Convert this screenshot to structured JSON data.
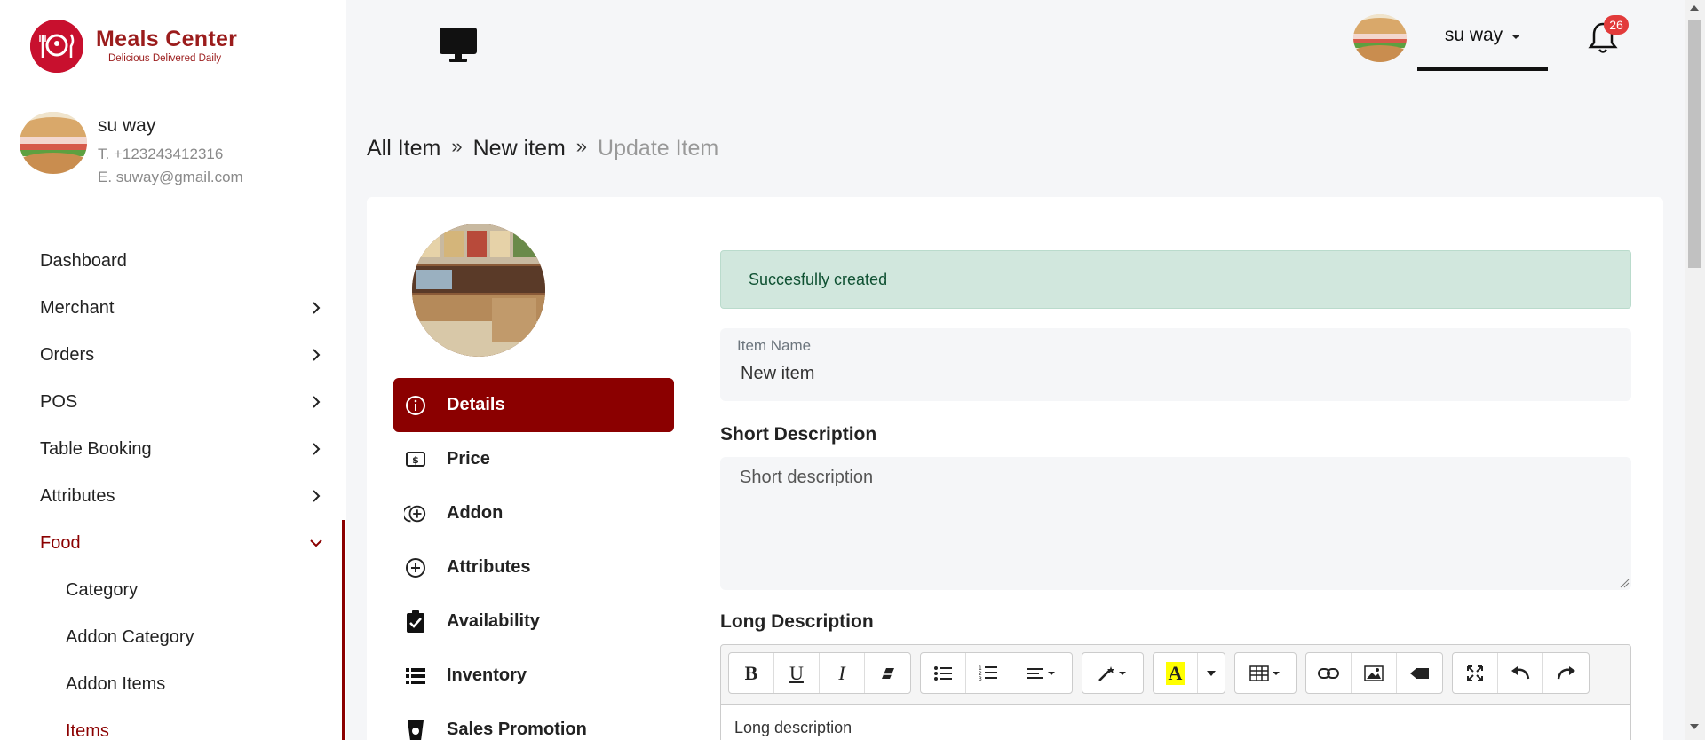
{
  "brand": {
    "name": "Meals Center",
    "tagline": "Delicious Delivered Daily",
    "color": "#9b1c1c"
  },
  "profile": {
    "name": "su way",
    "phone": "T. +123243412316",
    "email": "E. suway@gmail.com"
  },
  "nav": {
    "items": [
      {
        "label": "Dashboard",
        "has_children": false
      },
      {
        "label": "Merchant",
        "has_children": true
      },
      {
        "label": "Orders",
        "has_children": true
      },
      {
        "label": "POS",
        "has_children": true
      },
      {
        "label": "Table Booking",
        "has_children": true
      },
      {
        "label": "Attributes",
        "has_children": true
      },
      {
        "label": "Food",
        "has_children": true,
        "expanded": true,
        "active": true
      }
    ],
    "food_children": [
      {
        "label": "Category"
      },
      {
        "label": "Addon Category"
      },
      {
        "label": "Addon Items"
      },
      {
        "label": "Items",
        "active": true
      }
    ]
  },
  "topbar": {
    "user_name": "su way",
    "notification_count": "26",
    "monitor_icon": "desktop-icon",
    "bell_icon": "bell-icon"
  },
  "breadcrumb": {
    "items": [
      "All Item",
      "New item",
      "Update Item"
    ]
  },
  "tabs": [
    {
      "label": "Details",
      "icon": "info-icon",
      "active": true
    },
    {
      "label": "Price",
      "icon": "price-tag-icon"
    },
    {
      "label": "Addon",
      "icon": "addon-icon"
    },
    {
      "label": "Attributes",
      "icon": "plus-circle-icon"
    },
    {
      "label": "Availability",
      "icon": "clipboard-check-icon"
    },
    {
      "label": "Inventory",
      "icon": "list-icon"
    },
    {
      "label": "Sales Promotion",
      "icon": "cup-icon"
    }
  ],
  "form": {
    "alert": "Succesfully created",
    "item_name_label": "Item Name",
    "item_name_value": "New item",
    "short_description_label": "Short Description",
    "short_description_placeholder": "Short description",
    "long_description_label": "Long Description",
    "long_description_placeholder": "Long description"
  },
  "editor_toolbar": {
    "bold": "B",
    "underline": "U",
    "italic": "I",
    "highlight": "A"
  },
  "colors": {
    "accent": "#8b0000",
    "alert_bg": "#d1e7dd",
    "alert_text": "#0f5132",
    "badge": "#e23b3b"
  }
}
